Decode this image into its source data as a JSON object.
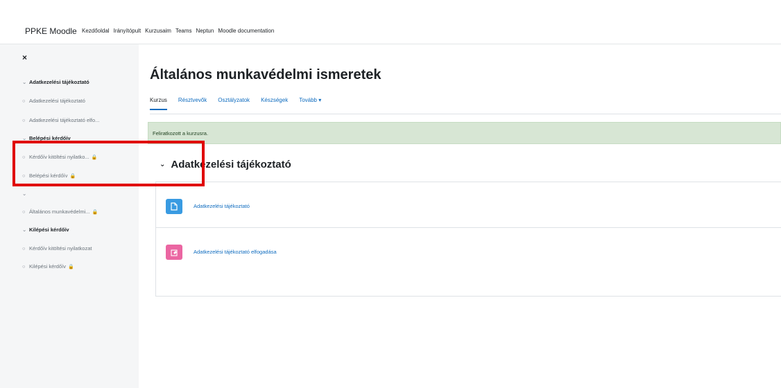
{
  "navbar": {
    "brand": "PPKE Moodle",
    "links": [
      "Kezdőoldal",
      "Irányítópult",
      "Kurzusaim",
      "Teams",
      "Neptun",
      "Moodle documentation"
    ]
  },
  "drawer": {
    "close_label": "×",
    "items": [
      {
        "label": "Adatkezelési tájékoztató",
        "type": "section",
        "locked": false
      },
      {
        "label": "Adatkezelési tájékoztató",
        "type": "activity",
        "locked": false
      },
      {
        "label": "Adatkezelési tájékoztató elfo...",
        "type": "activity",
        "locked": false
      },
      {
        "label": "Belépési kérdőív",
        "type": "section",
        "locked": false
      },
      {
        "label": "Kérdőív kitöltési nyilatko...",
        "type": "activity",
        "locked": true
      },
      {
        "label": "Belépési kérdőív",
        "type": "activity",
        "locked": true
      },
      {
        "label": "",
        "type": "section",
        "locked": false
      },
      {
        "label": "Általános munkavédelmi...",
        "type": "activity",
        "locked": true
      },
      {
        "label": "Kilépési kérdőív",
        "type": "section",
        "locked": false
      },
      {
        "label": "Kérdőív kitöltési nyilatkozat",
        "type": "activity",
        "locked": false
      },
      {
        "label": "Kilépési kérdőív",
        "type": "activity",
        "locked": true
      }
    ]
  },
  "main": {
    "title": "Általános munkavédelmi ismeretek",
    "tabs": [
      "Kurzus",
      "Résztvevők",
      "Osztályzatok",
      "Készségek",
      "Tovább ▾"
    ],
    "alert": "Feliratkozott a kurzusra.",
    "section_title": "Adatkezelési tájékoztató",
    "activities": [
      {
        "name": "Adatkezelési tájékoztató",
        "icon": "file-icon",
        "color": "#399be2"
      },
      {
        "name": "Adatkezelési tájékoztató elfogadása",
        "icon": "assignment-icon",
        "color": "#eb66a2"
      }
    ]
  },
  "colors": {
    "link": "#0f6cbf",
    "alert_bg": "#d7e6d4",
    "highlight": "#e00000"
  }
}
